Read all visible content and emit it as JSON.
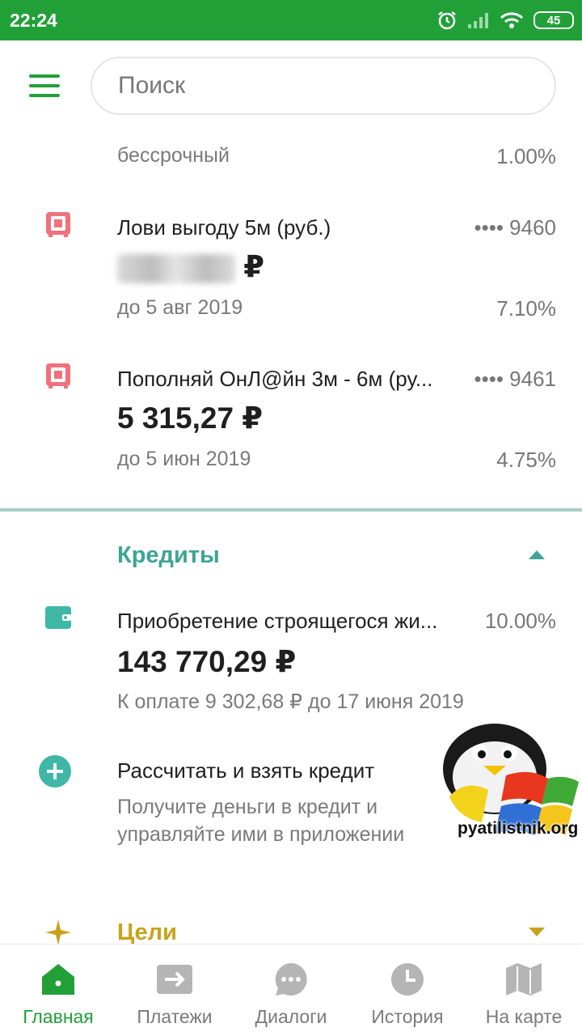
{
  "status": {
    "time": "22:24",
    "battery": "45"
  },
  "header": {
    "search_placeholder": "Поиск"
  },
  "deposits": [
    {
      "name": "",
      "sub": "бессрочный",
      "rate": "1.00%"
    },
    {
      "name": "Лови выгоду 5м (руб.)",
      "card": "•••• 9460",
      "amount_suffix": "₽",
      "sub": "до 5 авг 2019",
      "rate": "7.10%"
    },
    {
      "name": "Пополняй ОнЛ@йн 3м - 6м (ру...",
      "card": "•••• 9461",
      "amount": "5 315,27 ₽",
      "sub": "до 5 июн 2019",
      "rate": "4.75%"
    }
  ],
  "credits": {
    "title": "Кредиты",
    "item": {
      "name": "Приобретение строящегося жи...",
      "rate": "10.00%",
      "amount": "143 770,29 ₽",
      "sub": "К оплате 9 302,68 ₽ до 17 июня 2019"
    },
    "offer": {
      "title": "Рассчитать и взять кредит",
      "line1": "Получите деньги в кредит и",
      "line2": "управляйте ими в приложении"
    }
  },
  "goals": {
    "title": "Цели"
  },
  "watermark": {
    "text": "pyatilistnik.org"
  },
  "tabs": [
    {
      "label": "Главная",
      "icon": "home-icon"
    },
    {
      "label": "Платежи",
      "icon": "payments-icon"
    },
    {
      "label": "Диалоги",
      "icon": "dialogs-icon"
    },
    {
      "label": "История",
      "icon": "history-icon"
    },
    {
      "label": "На карте",
      "icon": "map-icon"
    }
  ],
  "colors": {
    "brand": "#21a038",
    "deposit_icon": "#f0717e",
    "credits_title": "#3da594",
    "goals": "#c9a21b"
  }
}
